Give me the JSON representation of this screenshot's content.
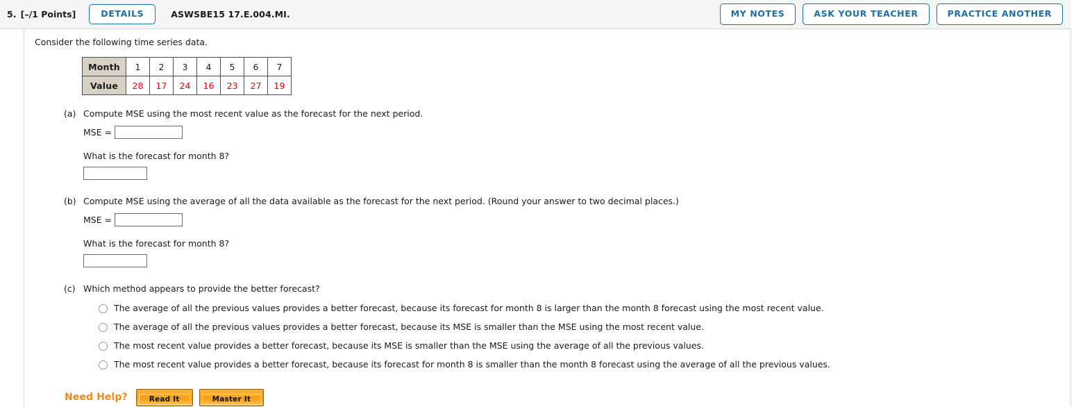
{
  "header": {
    "question_number": "5.",
    "points": "[–/1 Points]",
    "details_label": "DETAILS",
    "question_code": "ASWSBE15 17.E.004.MI.",
    "buttons": [
      {
        "label": "MY NOTES",
        "name": "my-notes-button"
      },
      {
        "label": "ASK YOUR TEACHER",
        "name": "ask-your-teacher-button"
      },
      {
        "label": "PRACTICE ANOTHER",
        "name": "practice-another-button"
      }
    ]
  },
  "body": {
    "intro": "Consider the following time series data.",
    "table": {
      "row_headers": [
        "Month",
        "Value"
      ],
      "months": [
        "1",
        "2",
        "3",
        "4",
        "5",
        "6",
        "7"
      ],
      "values": [
        "28",
        "17",
        "24",
        "16",
        "23",
        "27",
        "19"
      ]
    },
    "parts": [
      {
        "label": "(a)",
        "question": "Compute MSE using the most recent value as the forecast for the next period.",
        "mse_label": "MSE =",
        "mse_value": "",
        "subquestion": "What is the forecast for month 8?",
        "forecast_value": ""
      },
      {
        "label": "(b)",
        "question": "Compute MSE using the average of all the data available as the forecast for the next period. (Round your answer to two decimal places.)",
        "mse_label": "MSE =",
        "mse_value": "",
        "subquestion": "What is the forecast for month 8?",
        "forecast_value": ""
      },
      {
        "label": "(c)",
        "question": "Which method appears to provide the better forecast?",
        "choices": [
          "The average of all the previous values provides a better forecast, because its forecast for month 8 is larger than the month 8 forecast using the most recent value.",
          "The average of all the previous values provides a better forecast, because its MSE is smaller than the MSE using the most recent value.",
          "The most recent value provides a better forecast, because its MSE is smaller than the MSE using the average of all the previous values.",
          "The most recent value provides a better forecast, because its forecast for month 8 is smaller than the month 8 forecast using the average of all the previous values."
        ]
      }
    ],
    "need_help": {
      "label": "Need Help?",
      "read_it": "Read It",
      "master_it": "Master It"
    }
  },
  "colors": {
    "accent_blue": "#1c6ea4",
    "value_red": "#e8000d",
    "help_orange": "#ef8b20",
    "table_header_bg": "#d7d2c5"
  }
}
